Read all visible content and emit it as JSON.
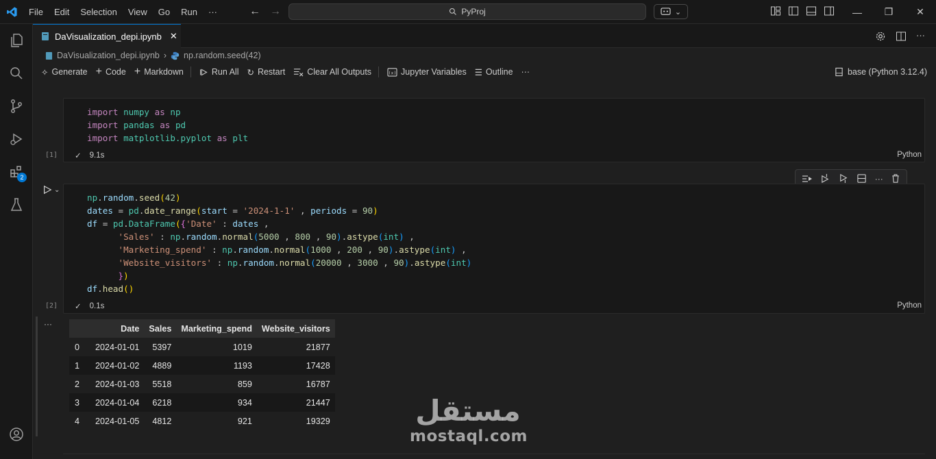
{
  "menu": [
    "File",
    "Edit",
    "Selection",
    "View",
    "Go",
    "Run",
    "···"
  ],
  "command_center": {
    "text": "PyProj"
  },
  "tab": {
    "label": "DaVisualization_depi.ipynb"
  },
  "breadcrumb": {
    "file": "DaVisualization_depi.ipynb",
    "symbol": "np.random.seed(42)"
  },
  "toolbar": {
    "generate": "Generate",
    "code": "Code",
    "markdown": "Markdown",
    "run_all": "Run All",
    "restart": "Restart",
    "clear_outputs": "Clear All Outputs",
    "jupyter_variables": "Jupyter Variables",
    "outline": "Outline",
    "more": "···",
    "kernel": "base (Python 3.12.4)"
  },
  "activity_badge": "2",
  "cells": [
    {
      "exec": "[1]",
      "time": "9.1s",
      "lang": "Python"
    },
    {
      "exec": "[2]",
      "time": "0.1s",
      "lang": "Python"
    }
  ],
  "output_dots": "···",
  "dataframe": {
    "columns": [
      "",
      "Date",
      "Sales",
      "Marketing_spend",
      "Website_visitors"
    ],
    "rows": [
      [
        "0",
        "2024-01-01",
        "5397",
        "1019",
        "21877"
      ],
      [
        "1",
        "2024-01-02",
        "4889",
        "1193",
        "17428"
      ],
      [
        "2",
        "2024-01-03",
        "5518",
        "859",
        "16787"
      ],
      [
        "3",
        "2024-01-04",
        "6218",
        "934",
        "21447"
      ],
      [
        "4",
        "2024-01-05",
        "4812",
        "921",
        "19329"
      ]
    ]
  },
  "watermark": {
    "arabic": "مستقل",
    "latin": "mostaql.com"
  },
  "colors": {
    "accent": "#0078d4",
    "background": "#1f1f1f",
    "cell_background": "#181818"
  }
}
